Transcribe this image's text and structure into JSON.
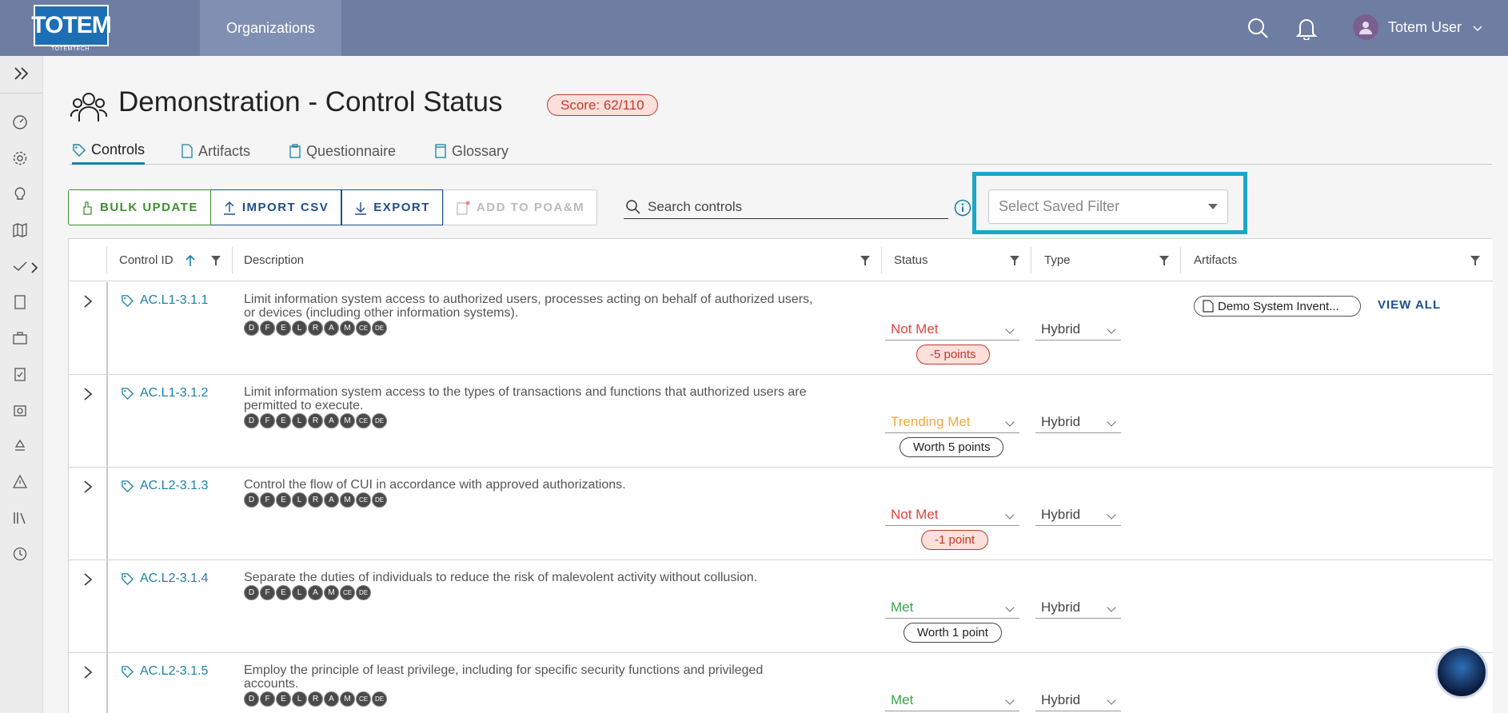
{
  "topbar": {
    "logo_text": "TOTEM",
    "logo_sub": "TOTEMTECH",
    "org_tab": "Organizations",
    "user_name": "Totem User"
  },
  "header": {
    "title": "Demonstration - Control Status",
    "score": "Score: 62/110"
  },
  "tabs": [
    {
      "label": "Controls",
      "active": true
    },
    {
      "label": "Artifacts"
    },
    {
      "label": "Questionnaire"
    },
    {
      "label": "Glossary"
    }
  ],
  "toolbar": {
    "bulk_update": "BULK UPDATE",
    "import_csv": "IMPORT CSV",
    "export": "EXPORT",
    "add_to_poam": "ADD TO POA&M",
    "search_placeholder": "Search controls",
    "saved_filter_placeholder": "Select Saved Filter"
  },
  "table": {
    "columns": [
      "Control ID",
      "Description",
      "Status",
      "Type",
      "Artifacts"
    ],
    "rows": [
      {
        "id": "AC.L1-3.1.1",
        "desc_line1": "Limit information system access to authorized users, processes acting on behalf of authorized users,",
        "desc_line2": "or devices (including other information systems).",
        "badges": [
          "D",
          "F",
          "E",
          "L",
          "R",
          "A",
          "M",
          "CE",
          "DE"
        ],
        "status": "Not Met",
        "points": "-5 points",
        "type": "Hybrid",
        "artifact": "Demo System Invent...",
        "view_all": "VIEW ALL"
      },
      {
        "id": "AC.L1-3.1.2",
        "desc_line1": "Limit information system access to the types of transactions and functions that authorized users are",
        "desc_line2": "permitted to execute.",
        "badges": [
          "D",
          "F",
          "E",
          "L",
          "R",
          "A",
          "M",
          "CE",
          "DE"
        ],
        "status": "Trending Met",
        "points": "Worth 5 points",
        "type": "Hybrid"
      },
      {
        "id": "AC.L2-3.1.3",
        "desc_line1": "Control the flow of CUI in accordance with approved authorizations.",
        "desc_line2": "",
        "badges": [
          "D",
          "F",
          "E",
          "L",
          "R",
          "A",
          "M",
          "CE",
          "DE"
        ],
        "status": "Not Met",
        "points": "-1 point",
        "type": "Hybrid"
      },
      {
        "id": "AC.L2-3.1.4",
        "desc_line1": "Separate the duties of individuals to reduce the risk of malevolent activity without collusion.",
        "desc_line2": "",
        "badges": [
          "D",
          "F",
          "E",
          "L",
          "A",
          "M",
          "CE",
          "DE"
        ],
        "status": "Met",
        "points": "Worth 1 point",
        "type": "Hybrid"
      },
      {
        "id": "AC.L2-3.1.5",
        "desc_line1": "Employ the principle of least privilege, including for specific security functions and privileged",
        "desc_line2": "accounts.",
        "badges": [
          "D",
          "F",
          "E",
          "L",
          "R",
          "A",
          "M",
          "CE",
          "DE"
        ],
        "status": "Met",
        "points": "",
        "type": "Hybrid"
      }
    ]
  },
  "colors": {
    "topbar": "#6e7ea3",
    "accent": "#1b80a8",
    "highlight": "#1aa7c5",
    "not_met": "#e0443b",
    "trending": "#f2a93b",
    "met": "#3aa64a"
  }
}
